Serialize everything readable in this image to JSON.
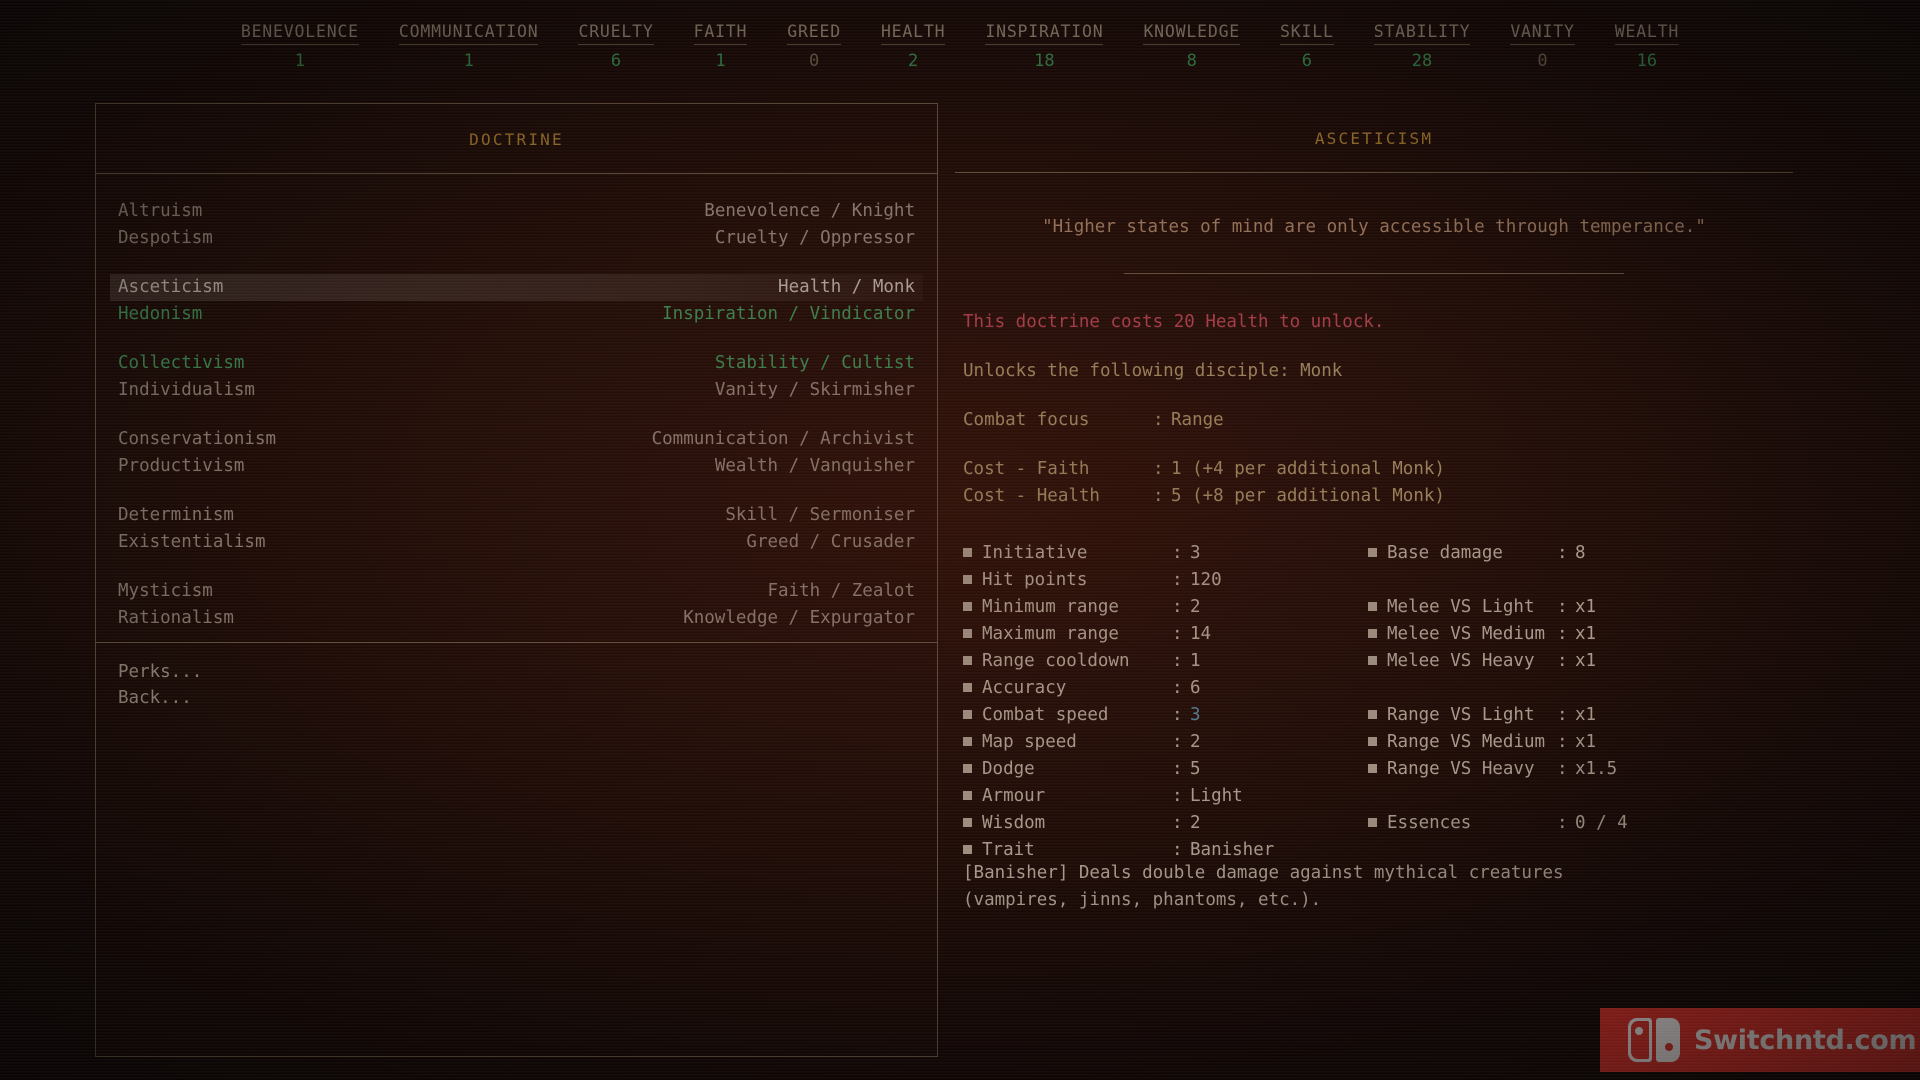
{
  "resources": [
    {
      "name": "BENEVOLENCE",
      "value": "1",
      "zero": false
    },
    {
      "name": "COMMUNICATION",
      "value": "1",
      "zero": false
    },
    {
      "name": "CRUELTY",
      "value": "6",
      "zero": false
    },
    {
      "name": "FAITH",
      "value": "1",
      "zero": false
    },
    {
      "name": "GREED",
      "value": "0",
      "zero": true
    },
    {
      "name": "HEALTH",
      "value": "2",
      "zero": false
    },
    {
      "name": "INSPIRATION",
      "value": "18",
      "zero": false
    },
    {
      "name": "KNOWLEDGE",
      "value": "8",
      "zero": false
    },
    {
      "name": "SKILL",
      "value": "6",
      "zero": false
    },
    {
      "name": "STABILITY",
      "value": "28",
      "zero": false
    },
    {
      "name": "VANITY",
      "value": "0",
      "zero": true
    },
    {
      "name": "WEALTH",
      "value": "16",
      "zero": false
    }
  ],
  "doctrine": {
    "title": "DOCTRINE",
    "rows": [
      {
        "name": "Altruism",
        "detail": "Benevolence / Knight",
        "state": "dim",
        "gap_after": false
      },
      {
        "name": "Despotism",
        "detail": "Cruelty / Oppressor",
        "state": "dim",
        "gap_after": true
      },
      {
        "name": "Asceticism",
        "detail": "Health / Monk",
        "state": "selected",
        "gap_after": false
      },
      {
        "name": "Hedonism",
        "detail": "Inspiration / Vindicator",
        "state": "green",
        "gap_after": true
      },
      {
        "name": "Collectivism",
        "detail": "Stability / Cultist",
        "state": "green",
        "gap_after": false
      },
      {
        "name": "Individualism",
        "detail": "Vanity / Skirmisher",
        "state": "dim",
        "gap_after": true
      },
      {
        "name": "Conservationism",
        "detail": "Communication / Archivist",
        "state": "dim",
        "gap_after": false
      },
      {
        "name": "Productivism",
        "detail": "Wealth / Vanquisher",
        "state": "dim",
        "gap_after": true
      },
      {
        "name": "Determinism",
        "detail": "Skill / Sermoniser",
        "state": "dim",
        "gap_after": false
      },
      {
        "name": "Existentialism",
        "detail": "Greed / Crusader",
        "state": "dim",
        "gap_after": true
      },
      {
        "name": "Mysticism",
        "detail": "Faith / Zealot",
        "state": "dim",
        "gap_after": false
      },
      {
        "name": "Rationalism",
        "detail": "Knowledge / Expurgator",
        "state": "dim",
        "gap_after": false
      }
    ],
    "footer": [
      {
        "label": "Perks..."
      },
      {
        "label": "Back..."
      }
    ]
  },
  "detail": {
    "title": "ASCETICISM",
    "quote": "\"Higher states of mind are only accessible through temperance.\"",
    "cost_line": "This doctrine costs 20 Health to unlock.",
    "unlock_line": "Unlocks the following disciple: Monk",
    "combat_focus_label": "Combat focus",
    "combat_focus_value": "Range",
    "cost_faith_label": "Cost - Faith",
    "cost_faith_value": "1 (+4 per additional Monk)",
    "cost_health_label": "Cost - Health",
    "cost_health_value": "5 (+8 per additional Monk)",
    "stats_left": [
      {
        "label": "Initiative",
        "value": "3",
        "accent": "normal"
      },
      {
        "label": "Hit points",
        "value": "120",
        "accent": "normal"
      },
      {
        "label": "Minimum range",
        "value": "2",
        "accent": "normal"
      },
      {
        "label": "Maximum range",
        "value": "14",
        "accent": "normal"
      },
      {
        "label": "Range cooldown",
        "value": "1",
        "accent": "normal"
      },
      {
        "label": "Accuracy",
        "value": "6",
        "accent": "normal"
      },
      {
        "label": "Combat speed",
        "value": "3",
        "accent": "blue"
      },
      {
        "label": "Map speed",
        "value": "2",
        "accent": "normal"
      },
      {
        "label": "Dodge",
        "value": "5",
        "accent": "normal"
      },
      {
        "label": "Armour",
        "value": "Light",
        "accent": "normal"
      },
      {
        "label": "Wisdom",
        "value": "2",
        "accent": "normal"
      },
      {
        "label": "Trait",
        "value": "Banisher",
        "accent": "normal"
      }
    ],
    "stats_right": [
      {
        "label": "Base damage",
        "value": "8",
        "accent": "normal"
      },
      {
        "label": "",
        "value": "",
        "accent": "empty"
      },
      {
        "label": "Melee VS Light",
        "value": "x1",
        "accent": "normal"
      },
      {
        "label": "Melee VS Medium",
        "value": "x1",
        "accent": "normal"
      },
      {
        "label": "Melee VS Heavy",
        "value": "x1",
        "accent": "normal"
      },
      {
        "label": "",
        "value": "",
        "accent": "empty"
      },
      {
        "label": "Range VS Light",
        "value": "x1",
        "accent": "normal"
      },
      {
        "label": "Range VS Medium",
        "value": "x1",
        "accent": "normal"
      },
      {
        "label": "Range VS Heavy",
        "value": "x1.5",
        "accent": "normal"
      },
      {
        "label": "",
        "value": "",
        "accent": "empty"
      },
      {
        "label": "Essences",
        "value": "0 / 4",
        "accent": "normal"
      },
      {
        "label": "",
        "value": "",
        "accent": "empty"
      }
    ],
    "trait_description": "[Banisher] Deals double damage against mythical creatures (vampires, jinns, phantoms, etc.)."
  },
  "watermark": {
    "text": "Switchntd.com",
    "icon": "nintendo-switch-logo",
    "color": "#e8312a"
  },
  "colors": {
    "background": "#100806",
    "border": "#6e5c47",
    "panel_title": "#b98b33",
    "text_dim": "#9f9184",
    "text_body": "#cbbfae",
    "green": "#3fa05f",
    "cost_red": "#c9485a",
    "quote": "#b08a6c",
    "blue_accent": "#5f97b8",
    "watermark_red": "#e8312a"
  }
}
